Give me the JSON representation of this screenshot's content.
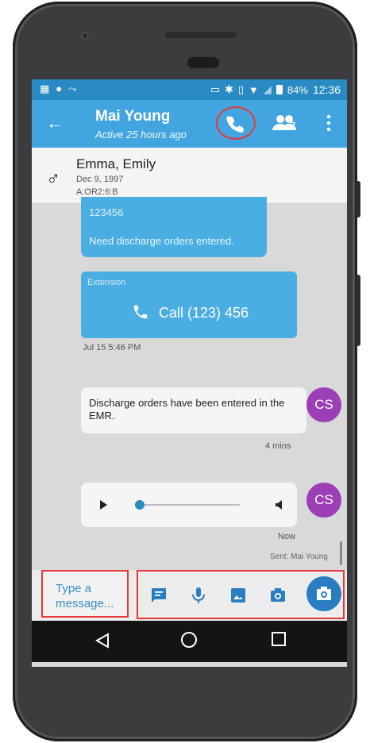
{
  "status_bar": {
    "battery": "84%",
    "time": "12:36"
  },
  "header": {
    "title": "Mai Young",
    "subtitle": "Active 25 hours ago",
    "participants_count": "2"
  },
  "patient": {
    "gender_symbol": "♂",
    "name": "Emma, Emily",
    "dob": "Dec 9, 1997",
    "location": "A:OR2:6:B"
  },
  "messages": {
    "partial_bubble": {
      "line1": "123456",
      "line2": "Need discharge orders entered."
    },
    "extension_card": {
      "label": "Extension",
      "call_label": "Call (123) 456"
    },
    "timestamp1": "Jul 15 5:46 PM",
    "reply": {
      "text": "Discharge orders have been entered in the EMR.",
      "avatar": "CS",
      "time": "4 mins"
    },
    "audio": {
      "avatar": "CS",
      "time": "Now",
      "sent_by": "Sent: Mai Young",
      "progress": 0.03
    }
  },
  "composer": {
    "placeholder": "Type a message..."
  },
  "colors": {
    "appbar": "#42a5e0",
    "statusbar": "#2a8ac4",
    "bubble_blue": "#4aaee3",
    "avatar": "#9c3fb6",
    "highlight": "#e53935"
  }
}
